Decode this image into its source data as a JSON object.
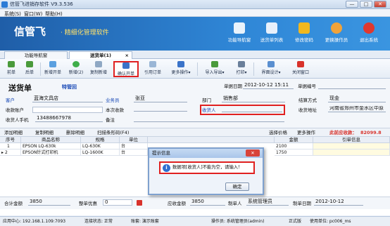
{
  "window": {
    "title": "信管飞进销存软件 V9.3.536",
    "min": "—",
    "max": "□",
    "close": "✕"
  },
  "menu": [
    "系统(S)",
    "窗口(W)",
    "帮助(H)"
  ],
  "banner": {
    "brand": "信管飞",
    "slogan": "· 精细化管理软件",
    "nav": [
      {
        "label": "功能导航窗",
        "icon": "grid-icon"
      },
      {
        "label": "送货单列表",
        "icon": "list-icon"
      },
      {
        "label": "修改密码",
        "icon": "lock-icon"
      },
      {
        "label": "更换操作员",
        "icon": "user-icon"
      },
      {
        "label": "退出系统",
        "icon": "exit-icon"
      }
    ]
  },
  "tabs": [
    {
      "label": "功能导航窗",
      "active": false
    },
    {
      "label": "送货单(1)",
      "active": true
    }
  ],
  "tab_close": "×",
  "toolbar": [
    {
      "label": "前单",
      "icon": "arrow-left-icon"
    },
    {
      "label": "后单",
      "icon": "arrow-right-icon"
    },
    {
      "label": "新增开单",
      "icon": "new-doc-icon"
    },
    {
      "label": "新增(2)",
      "icon": "add-icon"
    },
    {
      "label": "复制新增",
      "icon": "copy-icon"
    },
    {
      "label": "确认开单",
      "icon": "save-icon",
      "active": true
    },
    {
      "label": "引用订单",
      "icon": "quote-icon"
    },
    {
      "label": "更多操作",
      "icon": "more-icon",
      "dropdown": "▾"
    },
    {
      "label": "导入导出",
      "icon": "import-export-icon",
      "dropdown": "▾"
    },
    {
      "label": "打印",
      "icon": "print-icon",
      "dropdown": "▾"
    },
    {
      "label": "界面设计",
      "icon": "design-icon",
      "dropdown": "▾"
    },
    {
      "label": "关闭窗口",
      "icon": "close-window-icon"
    }
  ],
  "form": {
    "doc_title": "送货单",
    "doc_status": "特管回",
    "date_label": "单据日期",
    "date_value": "2012-10-12 15:11",
    "docno_label": "单据编号",
    "customer_label": "客户",
    "customer_value": "蓝海文具店",
    "salesman_label": "业务员",
    "salesman_value": "张亚",
    "dept_label": "部门",
    "dept_value": "销售部",
    "settle_label": "结算方式",
    "settle_value": "现金",
    "account_label": "收款账户",
    "received_label": "本次收款",
    "consignee_label": "收货人",
    "address_label": "收货地址",
    "address_value": "河南省郑州市金水区中原",
    "phone_label": "收货人手机",
    "phone_value": "13488667978",
    "remark_label": "备注"
  },
  "grid_toolbar": {
    "items": [
      "添加明细",
      "复制明细",
      "删除明细",
      "扫描条形码(F4)",
      "选择价格",
      "更多操作"
    ],
    "credit_label": "此前应收款：",
    "credit_value": "82099.8"
  },
  "grid": {
    "columns": [
      "序号",
      "商品名称",
      "规格",
      "单位",
      "金额",
      "引单信息"
    ],
    "rows": [
      {
        "no": "1",
        "name": "EPSON LQ-630k",
        "spec": "LQ-630K",
        "unit": "台",
        "amount": "2100"
      },
      {
        "no": "2",
        "name": "EPSON针式打印机",
        "spec": "LQ-1600K",
        "unit": "台",
        "amount": "1750"
      }
    ],
    "row_pointer": "▸"
  },
  "footer": {
    "total_label": "合计金额",
    "total_value": "3850",
    "discount_label": "整单优惠",
    "discount_value": "0",
    "paid_label": "应收金额",
    "paid_value": "3850",
    "maker_label": "制单人",
    "maker_value": "系统管理员",
    "make_date_label": "制单日期",
    "make_date_value": "2012-10-12"
  },
  "statusbar": {
    "center": "应用中心: 192.168.1.109:7093",
    "conn": "连接状态: 正常",
    "account": "账套: 演示账套",
    "operator": "操作员: 系统管理员(admin)",
    "version": "正式版",
    "machine": "使用单位: pc006_ms"
  },
  "dialog": {
    "title": "提示信息",
    "close": "✕",
    "message": "数据项[收货人]不能为空，请输入！",
    "ok_label": "确定",
    "info_glyph": "i"
  }
}
